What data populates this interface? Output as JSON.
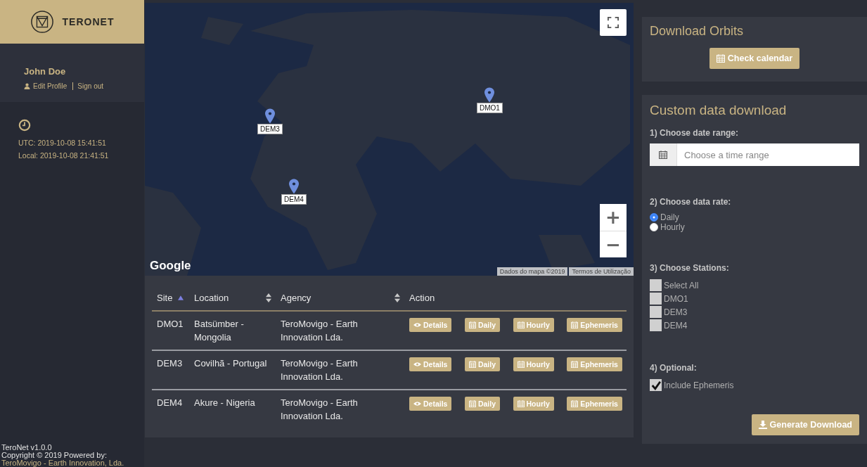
{
  "sidebar": {
    "brand": "TERONET",
    "user": {
      "name": "John Doe",
      "edit_profile": "Edit Profile",
      "sign_out": "Sign out"
    },
    "utc": "UTC: 2019-10-08 15:41:51",
    "local": "Local: 2019-10-08 21:41:51",
    "footer": {
      "version": "TeroNet v1.0.0",
      "copyright": "Copyright © 2019 Powered by:",
      "company": "TeroMovigo - Earth Innovation, Lda."
    }
  },
  "map": {
    "markers": [
      {
        "label": "DMO1"
      },
      {
        "label": "DEM3"
      },
      {
        "label": "DEM4"
      }
    ],
    "logo": "Google",
    "attribution": "Dados do mapa ©2019",
    "terms": "Termos de Utilização",
    "zoom_in": "+",
    "zoom_out": "−"
  },
  "table": {
    "columns": [
      {
        "label": "Site",
        "kind": "sortable",
        "sorted": true
      },
      {
        "label": "Location",
        "kind": "sortable",
        "sorted": false
      },
      {
        "label": "Agency",
        "kind": "sortable",
        "sorted": false
      },
      {
        "label": "Action",
        "kind": "plain"
      }
    ],
    "rows": [
      {
        "site": "DMO1",
        "location": "Batsümber - Mongolia",
        "agency": "TeroMovigo - Earth Innovation Lda.",
        "actions": [
          {
            "label": "Details",
            "kind": "eye"
          },
          {
            "label": "Daily",
            "kind": "calendar"
          },
          {
            "label": "Hourly",
            "kind": "calendar"
          },
          {
            "label": "Ephemeris",
            "kind": "calendar"
          }
        ]
      },
      {
        "site": "DEM3",
        "location": "Covilhã - Portugal",
        "agency": "TeroMovigo - Earth Innovation Lda.",
        "actions": [
          {
            "label": "Details",
            "kind": "eye"
          },
          {
            "label": "Daily",
            "kind": "calendar"
          },
          {
            "label": "Hourly",
            "kind": "calendar"
          },
          {
            "label": "Ephemeris",
            "kind": "calendar"
          }
        ]
      },
      {
        "site": "DEM4",
        "location": "Akure - Nigeria",
        "agency": "TeroMovigo - Earth Innovation Lda.",
        "actions": [
          {
            "label": "Details",
            "kind": "eye"
          },
          {
            "label": "Daily",
            "kind": "calendar"
          },
          {
            "label": "Hourly",
            "kind": "calendar"
          },
          {
            "label": "Ephemeris",
            "kind": "calendar"
          }
        ]
      }
    ]
  },
  "download_orbits": {
    "title": "Download Orbits",
    "button": "Check calendar"
  },
  "custom_download": {
    "title": "Custom data download",
    "date_label": "1) Choose date range:",
    "date_field": {
      "placeholder": "Choose a time range"
    },
    "rate_label": "2) Choose data rate:",
    "rates": [
      {
        "label": "Daily",
        "selected": true
      },
      {
        "label": "Hourly",
        "selected": false
      }
    ],
    "stations_label": "3) Choose Stations:",
    "stations": [
      {
        "label": "Select All",
        "checked": false
      },
      {
        "label": "DMO1",
        "checked": false
      },
      {
        "label": "DEM3",
        "checked": false
      },
      {
        "label": "DEM4",
        "checked": false
      }
    ],
    "optional_label": "4) Optional:",
    "options": [
      {
        "label": "Include Ephemeris",
        "checked": true
      }
    ],
    "button": "Generate Download"
  }
}
